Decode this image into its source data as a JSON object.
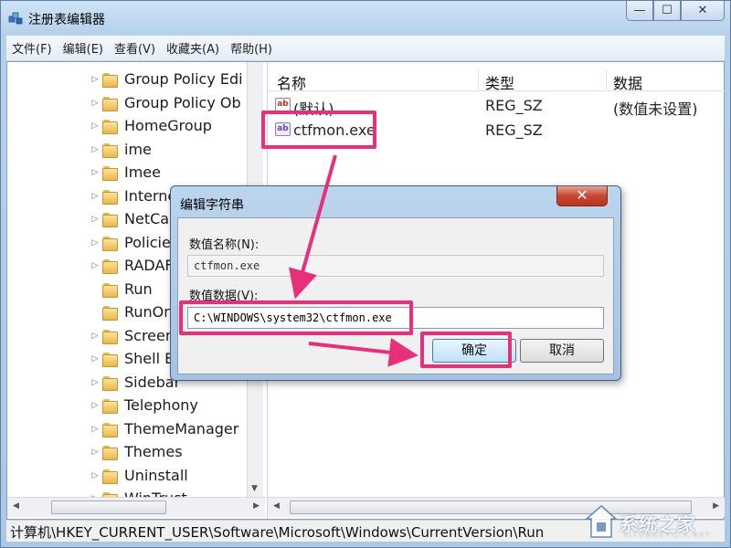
{
  "window": {
    "title": "注册表编辑器",
    "controls": {
      "minimize": "—",
      "maximize": "☐",
      "close": "✕"
    }
  },
  "menu": [
    "文件(F)",
    "编辑(E)",
    "查看(V)",
    "收藏夹(A)",
    "帮助(H)"
  ],
  "tree": {
    "items": [
      "Group Policy Edi",
      "Group Policy Ob",
      "HomeGroup",
      "ime",
      "Imee",
      "Interne",
      "NetCac",
      "Policie",
      "RADAF",
      "Run",
      "RunOn",
      "Screen",
      "Shell E",
      "Sidebar",
      "Telephony",
      "ThemeManager",
      "Themes",
      "Uninstall",
      "WinTrust"
    ]
  },
  "list": {
    "columns": [
      "名称",
      "类型",
      "数据"
    ],
    "rows": [
      {
        "name": "(默认)",
        "type": "REG_SZ",
        "data": "(数值未设置)"
      },
      {
        "name": "ctfmon.exe",
        "type": "REG_SZ",
        "data": ""
      }
    ]
  },
  "statusbar": "计算机\\HKEY_CURRENT_USER\\Software\\Microsoft\\Windows\\CurrentVersion\\Run",
  "dialog": {
    "title": "编辑字符串",
    "close": "✕",
    "name_label": "数值名称(N):",
    "name_value": "ctfmon.exe",
    "data_label": "数值数据(V):",
    "data_value": "C:\\WINDOWS\\system32\\ctfmon.exe",
    "ok": "确定",
    "cancel": "取消"
  },
  "highlight_color": "#e8307a",
  "watermark": {
    "text": "系统之家",
    "sub": "XITONGZHIJIA.NET"
  }
}
